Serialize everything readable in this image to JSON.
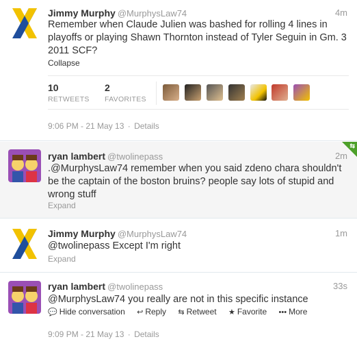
{
  "tweets": [
    {
      "name": "Jimmy Murphy",
      "handle": "@MurphysLaw74",
      "time": "4m",
      "text": "Remember when Claude Julien was bashed for rolling 4 lines in playoffs or playing Shawn Thornton instead of Tyler Seguin in Gm. 3 2011 SCF?",
      "link": "Collapse",
      "retweets_count": "10",
      "retweets_label": "RETWEETS",
      "favorites_count": "2",
      "favorites_label": "FAVORITES",
      "timestamp": "9:06 PM - 21 May 13",
      "details": "Details"
    },
    {
      "name": "ryan lambert",
      "handle": "@twolinepass",
      "time": "2m",
      "text": ".@MurphysLaw74 remember when you said zdeno chara shouldn't be the captain of the boston bruins? people say lots of stupid and wrong stuff",
      "link": "Expand"
    },
    {
      "name": "Jimmy Murphy",
      "handle": "@MurphysLaw74",
      "time": "1m",
      "text": "@twolinepass Except I'm right",
      "link": "Expand"
    },
    {
      "name": "ryan lambert",
      "handle": "@twolinepass",
      "time": "33s",
      "text": "@MurphysLaw74 you really are not in this specific instance",
      "actions": {
        "hide": "Hide conversation",
        "reply": "Reply",
        "retweet": "Retweet",
        "favorite": "Favorite",
        "more": "More"
      },
      "timestamp": "9:09 PM - 21 May 13",
      "details": "Details"
    }
  ],
  "colors": {
    "accent_green": "#4da02a",
    "ribbon_yellow": "#f2c200",
    "ribbon_blue": "#1f4e9c",
    "avatar_purple": "#9a4fb5"
  },
  "icons": [
    "speech-bubble-icon",
    "reply-arrow-icon",
    "retweet-icon",
    "star-icon",
    "ellipsis-icon",
    "retweet-corner-icon"
  ]
}
